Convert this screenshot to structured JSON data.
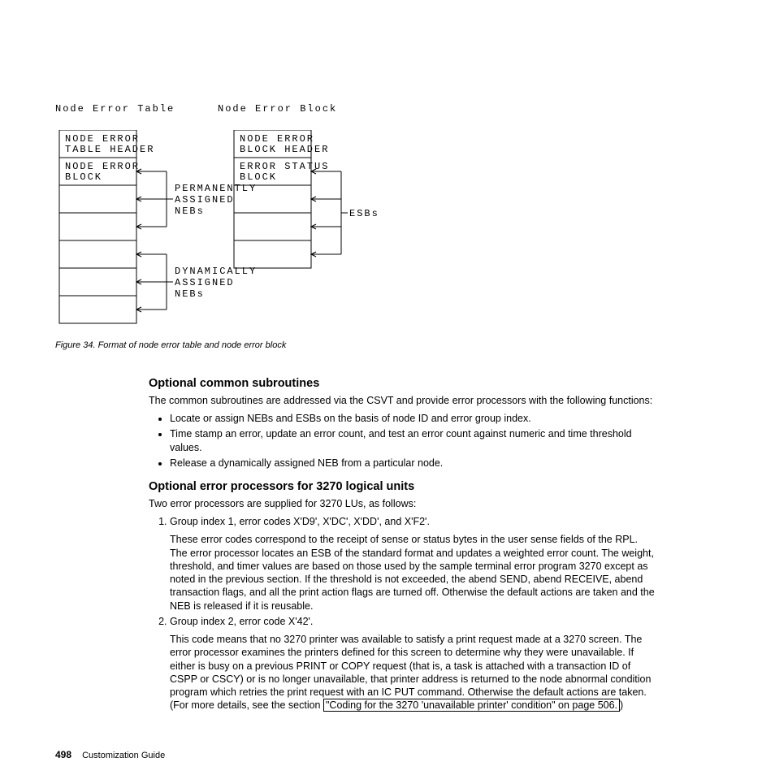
{
  "diagram": {
    "leftTitle": "Node Error Table",
    "rightTitle": "Node Error Block",
    "boxes": {
      "netHeader": "NODE ERROR\nTABLE HEADER",
      "netBlock": "NODE ERROR\nBLOCK",
      "permAssigned": "PERMANENTLY\nASSIGNED\nNEBs",
      "dynAssigned": "DYNAMICALLY\nASSIGNED\nNEBs",
      "nebHeader": "NODE ERROR\nBLOCK HEADER",
      "errStatus": "ERROR STATUS\nBLOCK",
      "esbs": "ESBs"
    }
  },
  "figureCaption": "Figure 34. Format of node error table and node error block",
  "section1": {
    "title": "Optional common subroutines",
    "intro": "The common subroutines are addressed via the CSVT and provide error processors with the following functions:",
    "bullets": [
      "Locate or assign NEBs and ESBs on the basis of node ID and error group index.",
      "Time stamp an error, update an error count, and test an error count against numeric and time threshold values.",
      "Release a dynamically assigned NEB from a particular node."
    ]
  },
  "section2": {
    "title": "Optional error processors for 3270 logical units",
    "intro": "Two error processors are supplied for 3270 LUs, as follows:",
    "item1": {
      "lead": "Group index 1, error codes X'D9', X'DC', X'DD', and X'F2'.",
      "body": "These error codes correspond to the receipt of sense or status bytes in the user sense fields of the RPL. The error processor locates an ESB of the standard format and updates a weighted error count. The weight, threshold, and timer values are based on those used by the sample terminal error program 3270 except as noted in the previous section. If the threshold is not exceeded, the abend SEND, abend RECEIVE, abend transaction flags, and all the print action flags are turned off. Otherwise the default actions are taken and the NEB is released if it is reusable."
    },
    "item2": {
      "lead": "Group index 2, error code X'42'.",
      "bodyPre": "This code means that no 3270 printer was available to satisfy a print request made at a 3270 screen. The error processor examines the printers defined for this screen to determine why they were unavailable. If either is busy on a previous PRINT or COPY request (that is, a task is attached with a transaction ID of CSPP or CSCY) or is no longer unavailable, that printer address is returned to the node abnormal condition program which retries the print request with an IC PUT command. Otherwise the default actions are taken. (For more details, see the section ",
      "link": "\"Coding for the 3270 'unavailable printer' condition\" on page 506.",
      "bodyPost": ")"
    }
  },
  "footer": {
    "pageNum": "498",
    "bookTitle": "Customization Guide"
  }
}
